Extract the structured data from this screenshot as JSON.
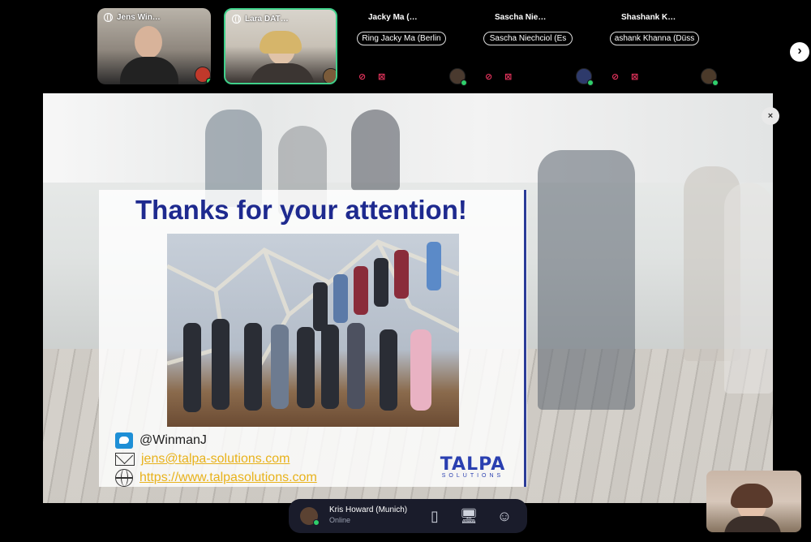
{
  "participants": [
    {
      "name": "Jens Win…",
      "type": "video"
    },
    {
      "name": "Lara DAT…",
      "type": "video",
      "active": true
    },
    {
      "name": "Jacky Ma (…",
      "pill": "Ring Jacky Ma (Berlin",
      "type": "audio",
      "muted": true
    },
    {
      "name": "Sascha Nie…",
      "pill": "Sascha Niechciol (Es",
      "type": "audio",
      "muted": true
    },
    {
      "name": "Shashank K…",
      "pill": "ashank Khanna (Düss",
      "type": "audio",
      "muted": true
    }
  ],
  "icons": {
    "globe": "globe-icon",
    "mic_off": "🎙̸",
    "cam_off": "📷̸",
    "next": "›",
    "close": "×",
    "map": "▯",
    "screen": "🖥",
    "emoji": "☺"
  },
  "slide": {
    "title": "Thanks for your attention!",
    "twitter": "@WinmanJ",
    "email": "jens@talpa-solutions.com",
    "website": "https://www.talpasolutions.com",
    "brand": "TALPA",
    "brand_sub": "SOLUTIONS"
  },
  "me": {
    "name": "Kris Howard (Munich)",
    "status": "Online"
  },
  "colors": {
    "accent_online": "#2fcf6b",
    "active_border": "#3fd08a",
    "muted": "#e4335c",
    "title_blue": "#1e2a8f",
    "link_gold": "#e8b21b",
    "bar_bg": "#1a1c2b"
  }
}
